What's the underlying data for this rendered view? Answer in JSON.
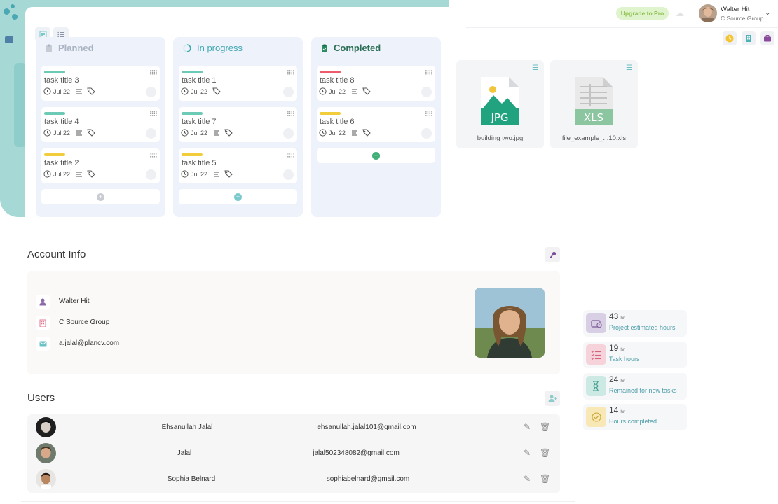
{
  "header": {
    "upgrade_label": "Upgrade to Pro",
    "user": {
      "name": "Walter Hit",
      "org": "C Source Group"
    }
  },
  "kanban": {
    "columns": [
      {
        "title": "Planned",
        "title_color": "#aab3c2",
        "add_color": "#c9ccd3",
        "cards": [
          {
            "title": "task title 3",
            "date": "Jul 22",
            "tag_color": "#6ccab6"
          },
          {
            "title": "task title 4",
            "date": "Jul 22",
            "tag_color": "#6ccab6"
          },
          {
            "title": "task title 2",
            "date": "Jul 22",
            "tag_color": "#f1cd3b"
          }
        ]
      },
      {
        "title": "In progress",
        "title_color": "#3fa7b0",
        "add_color": "#7cc9cd",
        "cards": [
          {
            "title": "task title 1",
            "date": "Jul 22",
            "tag_color": "#6ccab6"
          },
          {
            "title": "task title 7",
            "date": "Jul 22",
            "tag_color": "#6ccab6"
          },
          {
            "title": "task title 5",
            "date": "Jul 22",
            "tag_color": "#f1cd3b"
          }
        ]
      },
      {
        "title": "Completed",
        "title_color": "#2a8a60",
        "add_color": "#3fae77",
        "cards": [
          {
            "title": "task title 8",
            "date": "Jul 22",
            "tag_color": "#ee5b6c"
          },
          {
            "title": "task title 6",
            "date": "Jul 22",
            "tag_color": "#f1cd3b"
          }
        ]
      }
    ]
  },
  "files": [
    {
      "name": "building two.jpg",
      "ext": "JPG",
      "color": "#22a37f"
    },
    {
      "name": "file_example_...10.xls",
      "ext": "XLS",
      "color": "#8cc6a0"
    }
  ],
  "account": {
    "title": "Account Info",
    "name": "Walter Hit",
    "org": "C Source Group",
    "email": "a.jalal@plancv.com"
  },
  "users": {
    "title": "Users",
    "rows": [
      {
        "name": "Ehsanullah Jalal",
        "email": "ehsanullah.jalal101@gmail.com"
      },
      {
        "name": "Jalal",
        "email": "jalal502348082@gmail.com"
      },
      {
        "name": "Sophia Belnard",
        "email": "sophiabelnard@gmail.com"
      }
    ]
  },
  "stats": [
    {
      "value": "43",
      "unit": "hr",
      "label": "Project estimated hours",
      "bg": "#d9cfe4",
      "fg": "#7b5c99"
    },
    {
      "value": "19",
      "unit": "hr",
      "label": "Task hours",
      "bg": "#f6d2da",
      "fg": "#d4637c"
    },
    {
      "value": "24",
      "unit": "hr",
      "label": "Remained for new tasks",
      "bg": "#cde9e3",
      "fg": "#3f9d8f"
    },
    {
      "value": "14",
      "unit": "hr",
      "label": "Hours completed",
      "bg": "#f7e8b6",
      "fg": "#caa431"
    }
  ]
}
